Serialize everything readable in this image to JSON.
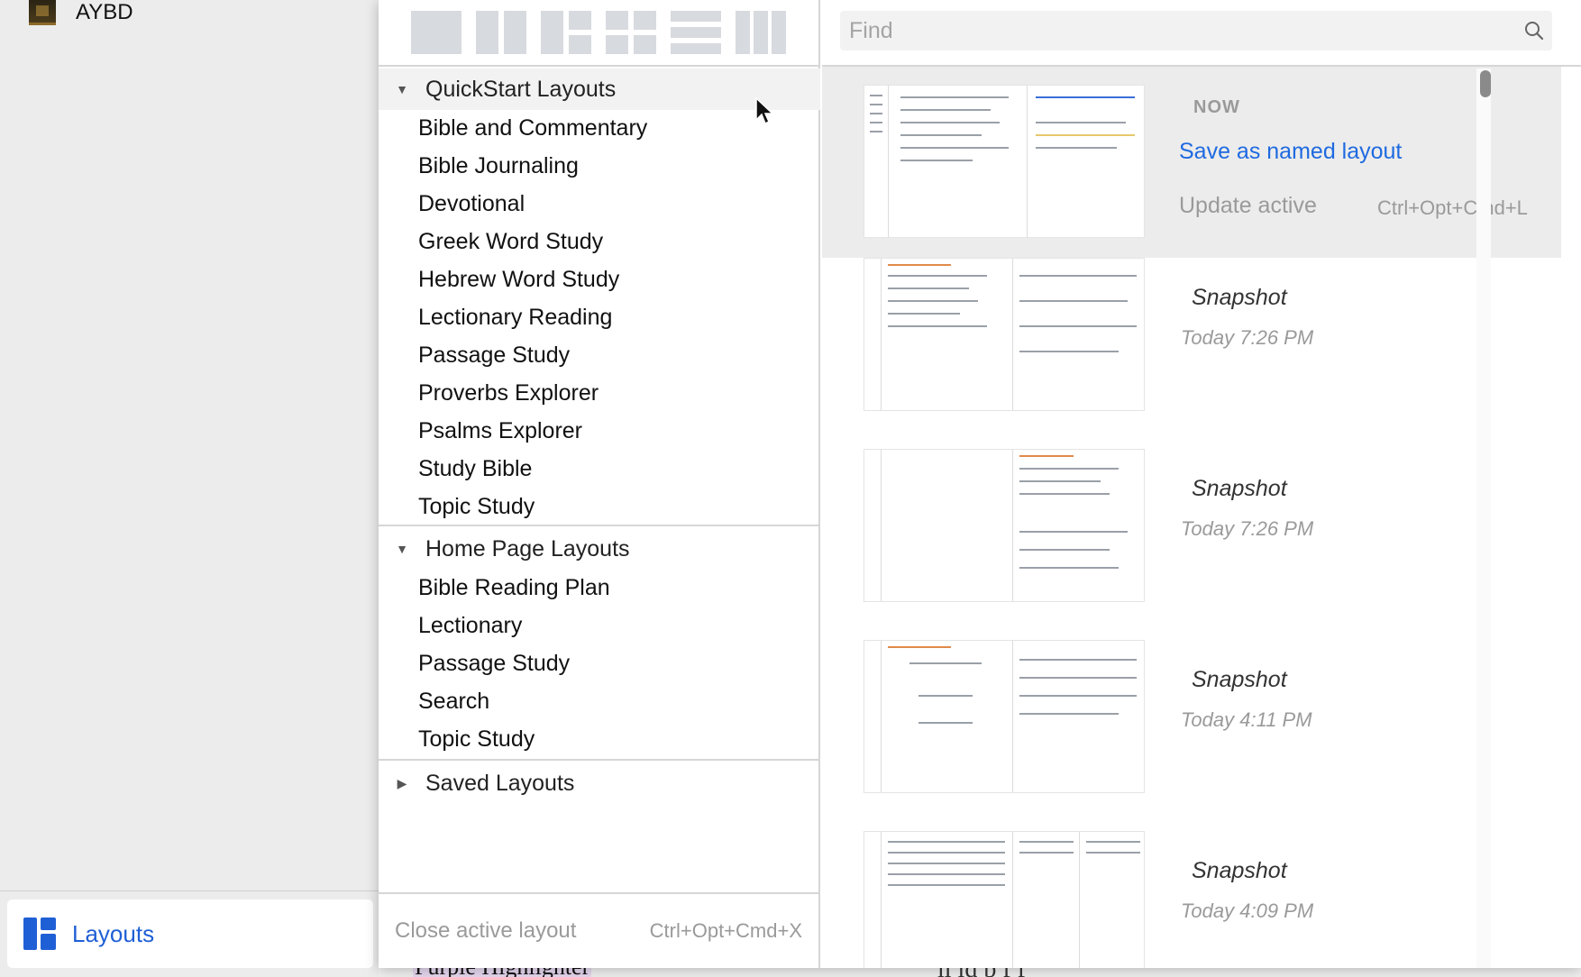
{
  "sidebar": {
    "book_title": "AYBD",
    "layouts_button_label": "Layouts"
  },
  "background": {
    "doc_left_text": "Purple Highlighter",
    "doc_right_text": "li   ld b       f         f"
  },
  "templates": {
    "icons": [
      "single-pane",
      "two-columns",
      "three-pane",
      "four-pane",
      "rows",
      "three-columns"
    ]
  },
  "sections": [
    {
      "title": "QuickStart Layouts",
      "expanded": true,
      "items": [
        "Bible and Commentary",
        "Bible Journaling",
        "Devotional",
        "Greek Word Study",
        "Hebrew Word Study",
        "Lectionary Reading",
        "Passage Study",
        "Proverbs Explorer",
        "Psalms Explorer",
        "Study Bible",
        "Topic Study"
      ]
    },
    {
      "title": "Home Page Layouts",
      "expanded": true,
      "items": [
        "Bible Reading Plan",
        "Lectionary",
        "Passage Study",
        "Search",
        "Topic Study"
      ]
    },
    {
      "title": "Saved Layouts",
      "expanded": false,
      "items": []
    }
  ],
  "footer": {
    "close_label": "Close active layout",
    "close_shortcut": "Ctrl+Opt+Cmd+X"
  },
  "find": {
    "placeholder": "Find",
    "value": ""
  },
  "current": {
    "now_label": "NOW",
    "save_named_label": "Save as named layout",
    "update_active_label": "Update active",
    "update_active_shortcut": "Ctrl+Opt+Cmd+L"
  },
  "snapshots": [
    {
      "title": "Snapshot",
      "time": "Today 7:26 PM"
    },
    {
      "title": "Snapshot",
      "time": "Today 7:26 PM"
    },
    {
      "title": "Snapshot",
      "time": "Today 4:11 PM"
    },
    {
      "title": "Snapshot",
      "time": "Today 4:09 PM"
    }
  ],
  "colors": {
    "accent": "#1f6ae0",
    "sidebar_bg": "#ececec",
    "muted_text": "#9a9a9a"
  }
}
